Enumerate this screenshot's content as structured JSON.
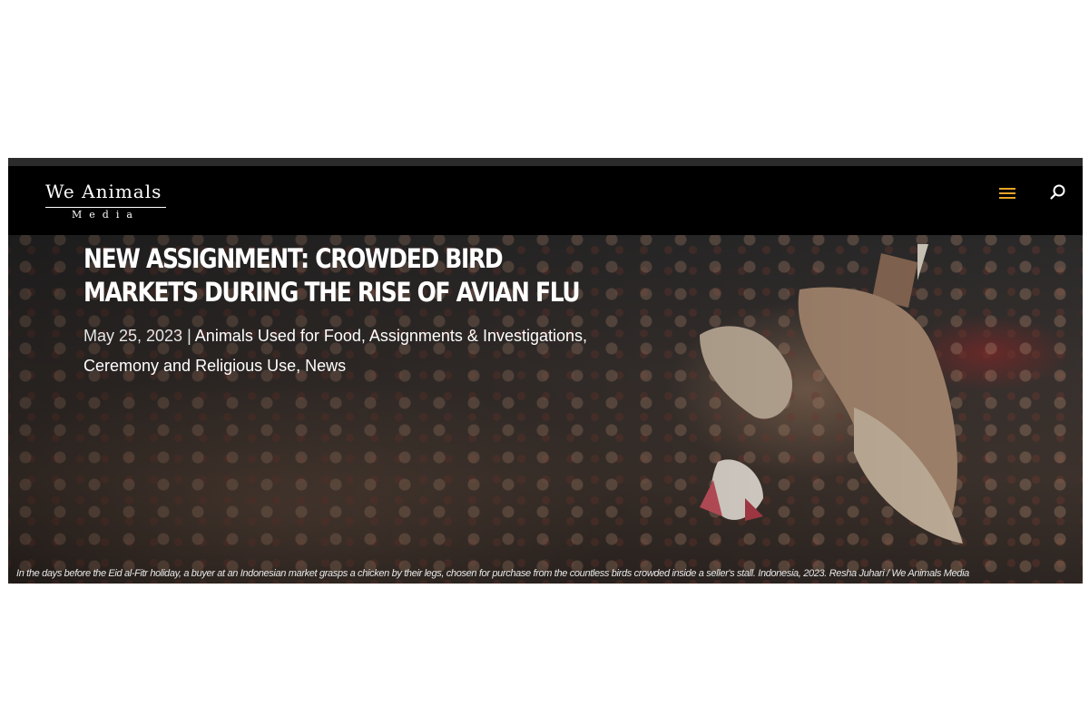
{
  "brand": {
    "logo_main": "We Animals",
    "logo_sub": "Media"
  },
  "nav": {
    "menu_icon": "hamburger-menu-icon",
    "search_icon": "search-icon",
    "accent_color": "#e8a427"
  },
  "post": {
    "title": "NEW ASSIGNMENT: CROWDED BIRD MARKETS DURING THE RISE OF AVIAN FLU",
    "date": "May 25, 2023",
    "separator": "|",
    "categories": [
      "Animals Used for Food",
      "Assignments & Investigations",
      "Ceremony and Religious Use",
      "News"
    ]
  },
  "photo": {
    "caption": "In the days before the Eid al-Fitr holiday, a buyer at an Indonesian market grasps a chicken by their legs, chosen for purchase from the countless birds crowded inside a seller's stall. Indonesia, 2023. Resha Juhari / We Animals Media"
  }
}
